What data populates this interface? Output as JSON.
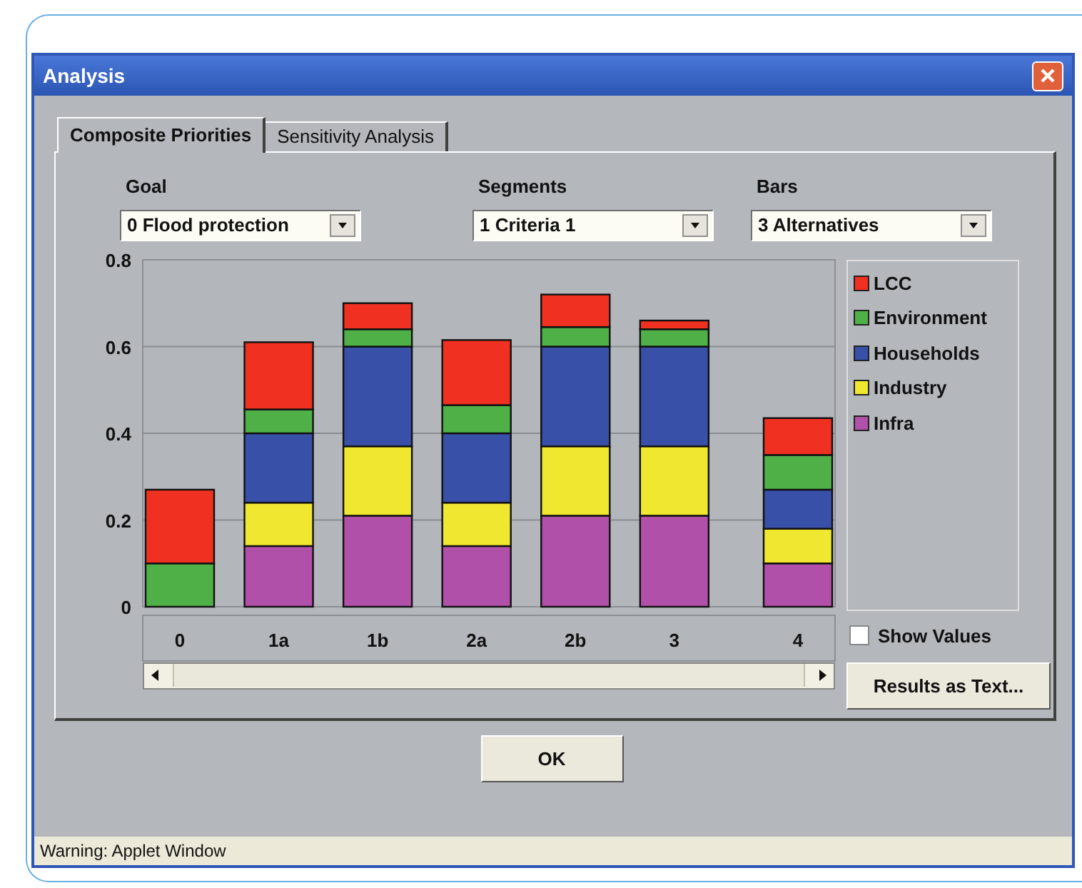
{
  "window": {
    "title": "Analysis"
  },
  "tabs": [
    {
      "label": "Composite Priorities",
      "selected": true
    },
    {
      "label": "Sensitivity Analysis",
      "selected": false
    }
  ],
  "selectors": [
    {
      "label": "Goal",
      "value": "0 Flood protection"
    },
    {
      "label": "Segments",
      "value": "1 Criteria 1"
    },
    {
      "label": "Bars",
      "value": "3 Alternatives"
    }
  ],
  "chart_data": {
    "type": "bar",
    "stacked": true,
    "grid": true,
    "categories": [
      "0",
      "1a",
      "1b",
      "2a",
      "2b",
      "3",
      "4"
    ],
    "ylim": [
      0,
      0.8
    ],
    "yticks": [
      0,
      0.2,
      0.4,
      0.6,
      0.8
    ],
    "series": [
      {
        "name": "Infra",
        "color": "#b050a8",
        "values": [
          0,
          0.14,
          0.21,
          0.14,
          0.21,
          0.21,
          0.1
        ]
      },
      {
        "name": "Industry",
        "color": "#f0e830",
        "values": [
          0,
          0.1,
          0.16,
          0.1,
          0.16,
          0.16,
          0.08
        ]
      },
      {
        "name": "Households",
        "color": "#3850a8",
        "values": [
          0,
          0.16,
          0.23,
          0.16,
          0.23,
          0.23,
          0.09
        ]
      },
      {
        "name": "Environment",
        "color": "#50b048",
        "values": [
          0.1,
          0.055,
          0.04,
          0.065,
          0.045,
          0.04,
          0.08
        ]
      },
      {
        "name": "LCC",
        "color": "#f03020",
        "values": [
          0.17,
          0.155,
          0.06,
          0.15,
          0.075,
          0.02,
          0.085
        ]
      }
    ]
  },
  "show_values": {
    "label": "Show Values",
    "checked": false
  },
  "results_button": "Results as Text...",
  "ok_button": "OK",
  "status_bar": "Warning: Applet Window"
}
